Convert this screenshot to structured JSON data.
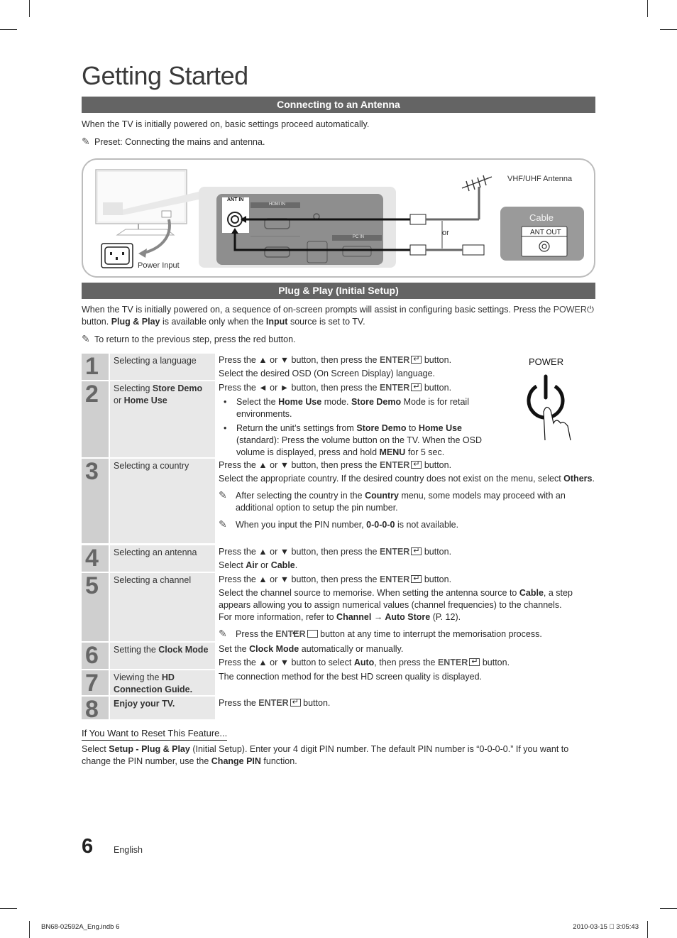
{
  "page": {
    "title": "Getting Started",
    "page_number": "6",
    "language": "English",
    "slug_left": "BN68-02592A_Eng.indb   6",
    "slug_right": "2010-03-15   ￿ 3:05:43"
  },
  "antenna_section": {
    "heading": "Connecting to an Antenna",
    "intro": "When the TV is initially powered on, basic settings proceed automatically.",
    "note": "Preset: Connecting the mains and antenna.",
    "diagram": {
      "power_input_label": "Power Input",
      "ant_in_label": "ANT IN",
      "hdmi_in_label": "HDMI IN",
      "pc_in_label": "PC IN",
      "antenna_label": "VHF/UHF Antenna",
      "or_label": "or",
      "cable_label": "Cable",
      "ant_out_label": "ANT OUT"
    }
  },
  "plug_play_section": {
    "heading": "Plug & Play (Initial Setup)",
    "intro_1": "When the TV is initially powered on, a sequence of on-screen prompts will assist in configuring basic settings. Press the",
    "intro_power": "POWER",
    "intro_2": "button.",
    "intro_bold_1": "Plug & Play",
    "intro_3": "is available only when the",
    "intro_bold_2": "Input",
    "intro_4": "source is set to TV.",
    "note": "To return to the previous step, press the red button.",
    "power_illustration_label": "POWER"
  },
  "steps": [
    {
      "number": "1",
      "name": "Selecting a language",
      "lines": [
        "Press the ▲ or ▼ button, then press the",
        "ENTER",
        "button.",
        "Select the desired OSD (On Screen Display) language."
      ]
    },
    {
      "number": "2",
      "name_pre": "Selecting",
      "name_bold_1": "Store Demo",
      "name_mid": "or",
      "name_bold_2": "Home Use",
      "line_1": "Press the ◄ or ► button, then press the",
      "enter": "ENTER",
      "button": "button.",
      "bullet_1": {
        "pre": "Select the",
        "b1": "Home Use",
        "mid": "mode.",
        "b2": "Store Demo",
        "post": "Mode is for retail environments."
      },
      "bullet_2": {
        "pre": "Return the unit’s settings from",
        "b1": "Store Demo",
        "mid": "to",
        "b2": "Home Use",
        "post": "(standard): Press the volume button on the TV. When the OSD volume is displayed, press and hold",
        "b3": "MENU",
        "post2": "for 5 sec."
      }
    },
    {
      "number": "3",
      "name": "Selecting a country",
      "line_1": "Press the ▲ or ▼ button, then press the",
      "enter": "ENTER",
      "button": "button.",
      "line_2": "Select the appropriate country. If the desired country does not exist on the menu, select",
      "line_2_bold": "Others",
      "note_1_pre": "After selecting the country in the",
      "note_1_bold": "Country",
      "note_1_post": "menu, some models may proceed with an additional option to setup the pin number.",
      "note_2_pre": "When you input the PIN number,",
      "note_2_bold": "0-0-0-0",
      "note_2_post": "is not available."
    },
    {
      "number": "4",
      "name": "Selecting an antenna",
      "line_1": "Press the ▲ or ▼ button, then press the",
      "enter": "ENTER",
      "button": "button.",
      "line_2_pre": "Select",
      "line_2_b1": "Air",
      "line_2_mid": "or",
      "line_2_b2": "Cable"
    },
    {
      "number": "5",
      "name": "Selecting a channel",
      "line_1": "Press the ▲ or ▼ button, then press the",
      "enter": "ENTER",
      "button": "button.",
      "line_2_pre": "Select the channel source to memorise. When setting the antenna source to",
      "line_2_bold": "Cable",
      "line_2_post": ", a step appears allowing you to assign numerical values (channel frequencies) to the channels.",
      "line_3_pre": "For more information, refer to",
      "line_3_bold": "Channel → Auto Store",
      "line_3_post": "(P. 12).",
      "note_pre": "Press the",
      "note_enter": "ENTER",
      "note_post": "button at any time to interrupt the memorisation process."
    },
    {
      "number": "6",
      "name_pre": "Setting the",
      "name_bold": "Clock Mode",
      "line_1_pre": "Set the",
      "line_1_bold": "Clock Mode",
      "line_1_post": "automatically or manually.",
      "line_2_pre": "Press the ▲ or ▼ button to select",
      "line_2_bold": "Auto",
      "line_2_mid": ", then press the",
      "enter": "ENTER",
      "button": "button."
    },
    {
      "number": "7",
      "name_pre": "Viewing the",
      "name_bold": "HD Connection Guide.",
      "line_1": "The connection method for the best HD screen quality is displayed."
    },
    {
      "number": "8",
      "name_bold": "Enjoy your TV.",
      "line_1_pre": "Press the",
      "enter": "ENTER",
      "button": "button."
    }
  ],
  "reset": {
    "title": "If You Want to Reset This Feature...",
    "pre": "Select",
    "b1": "Setup - Plug & Play",
    "mid": "(Initial Setup). Enter your 4 digit PIN number. The default PIN number is “0-0-0-0.” If you want to change the PIN number, use the",
    "b2": "Change PIN",
    "post": "function."
  },
  "icons": {
    "note": "pencil-note-icon",
    "enter": "enter-key-icon",
    "power": "power-icon"
  }
}
